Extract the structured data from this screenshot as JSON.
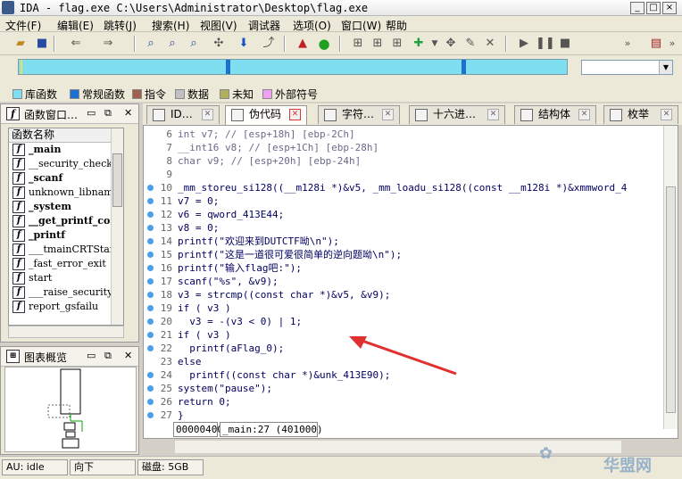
{
  "window": {
    "title": "IDA - flag.exe C:\\Users\\Administrator\\Desktop\\flag.exe",
    "minimize": "_",
    "maximize": "□",
    "close": "×"
  },
  "menu": [
    "文件(F)",
    "编辑(E)",
    "跳转(J)",
    "搜索(H)",
    "视图(V)",
    "调试器",
    "选项(O)",
    "窗口(W)",
    "帮助"
  ],
  "legend": [
    {
      "label": "库函数",
      "color": "#7fdff0"
    },
    {
      "label": "常规函数",
      "color": "#1e70d0"
    },
    {
      "label": "指令",
      "color": "#a06050"
    },
    {
      "label": "数据",
      "color": "#c0c0c0"
    },
    {
      "label": "未知",
      "color": "#b0b060"
    },
    {
      "label": "外部符号",
      "color": "#f0a0f0"
    }
  ],
  "functions_panel": {
    "title": "函数窗口…",
    "column": "函数名称",
    "items": [
      {
        "name": "_main",
        "bold": true
      },
      {
        "name": "__security_check_",
        "bold": false
      },
      {
        "name": "_scanf",
        "bold": true
      },
      {
        "name": "unknown_libname_1",
        "bold": false
      },
      {
        "name": "_system",
        "bold": true
      },
      {
        "name": "__get_printf_co",
        "bold": true
      },
      {
        "name": "_printf",
        "bold": true
      },
      {
        "name": "___tmainCRTStartu",
        "bold": false
      },
      {
        "name": "_fast_error_exit",
        "bold": false
      },
      {
        "name": "start",
        "bold": false
      },
      {
        "name": "___raise_security",
        "bold": false
      },
      {
        "name": "report_gsfailu",
        "bold": false
      }
    ]
  },
  "overview_panel": {
    "title": "图表概览"
  },
  "tabs": [
    {
      "label": "ID…",
      "active": false
    },
    {
      "label": "伪代码",
      "active": true
    },
    {
      "label": "字符…",
      "active": false
    },
    {
      "label": "十六进…",
      "active": false
    },
    {
      "label": "结构体",
      "active": false
    },
    {
      "label": "枚举",
      "active": false
    }
  ],
  "code_lines": [
    {
      "n": "6",
      "text": "int v7; // [esp+18h] [ebp-2Ch]",
      "dot": false,
      "gray": true
    },
    {
      "n": "7",
      "text": "__int16 v8; // [esp+1Ch] [ebp-28h]",
      "dot": false,
      "gray": true
    },
    {
      "n": "8",
      "text": "char v9; // [esp+20h] [ebp-24h]",
      "dot": false,
      "gray": true
    },
    {
      "n": "9",
      "text": "",
      "dot": false,
      "gray": false
    },
    {
      "n": "10",
      "text": "_mm_storeu_si128((__m128i *)&v5, _mm_loadu_si128((const __m128i *)&xmmword_4",
      "dot": true,
      "gray": false
    },
    {
      "n": "11",
      "text": "v7 = 0;",
      "dot": true,
      "gray": false
    },
    {
      "n": "12",
      "text": "v6 = qword_413E44;",
      "dot": true,
      "gray": false
    },
    {
      "n": "13",
      "text": "v8 = 0;",
      "dot": true,
      "gray": false
    },
    {
      "n": "14",
      "text": "printf(\"欢迎来到DUTCTF呦\\n\");",
      "dot": true,
      "gray": false
    },
    {
      "n": "15",
      "text": "printf(\"这是一道很可爱很简单的逆向题呦\\n\");",
      "dot": true,
      "gray": false
    },
    {
      "n": "16",
      "text": "printf(\"输入flag吧:\");",
      "dot": true,
      "gray": false
    },
    {
      "n": "17",
      "text": "scanf(\"%s\", &v9);",
      "dot": true,
      "gray": false
    },
    {
      "n": "18",
      "text": "v3 = strcmp((const char *)&v5, &v9);",
      "dot": true,
      "gray": false
    },
    {
      "n": "19",
      "text": "if ( v3 )",
      "dot": true,
      "gray": false
    },
    {
      "n": "20",
      "text": "  v3 = -(v3 < 0) | 1;",
      "dot": true,
      "gray": false
    },
    {
      "n": "21",
      "text": "if ( v3 )",
      "dot": true,
      "gray": false
    },
    {
      "n": "22",
      "text": "  printf(aFlag_0);",
      "dot": true,
      "gray": false
    },
    {
      "n": "23",
      "text": "else",
      "dot": false,
      "gray": false
    },
    {
      "n": "24",
      "text": "  printf((const char *)&unk_413E90);",
      "dot": true,
      "gray": false
    },
    {
      "n": "25",
      "text": "system(\"pause\");",
      "dot": true,
      "gray": false
    },
    {
      "n": "26",
      "text": "return 0;",
      "dot": true,
      "gray": false
    },
    {
      "n": "27",
      "text": "}",
      "dot": true,
      "gray": false
    }
  ],
  "code_status": {
    "offset": "00000400",
    "location": "_main:27 (401000)"
  },
  "statusbar": {
    "au": "AU:",
    "state": "idle",
    "direction": "向下",
    "disk": "磁盘: 5GB"
  },
  "watermark": {
    "text": "华盟网"
  }
}
